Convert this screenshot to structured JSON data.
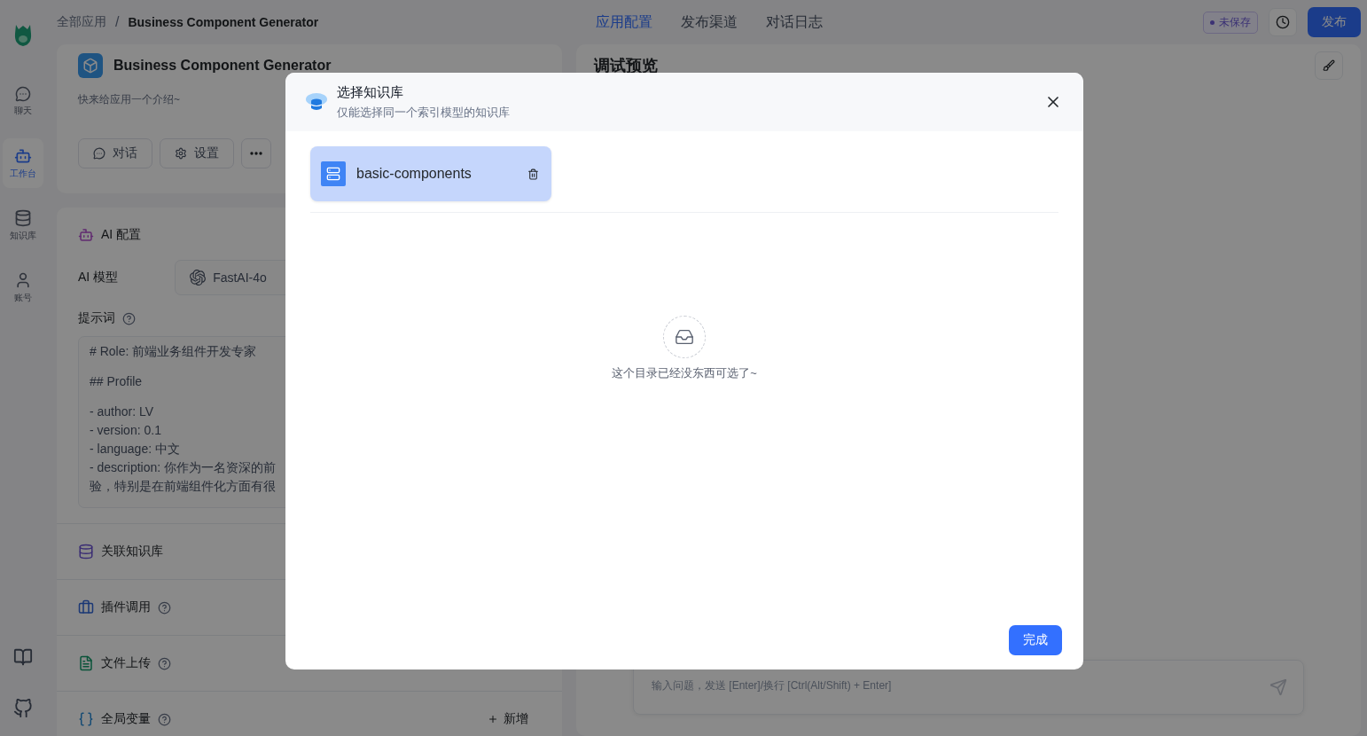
{
  "sidebar": {
    "items": [
      {
        "label": "聊天",
        "kind": "chat",
        "selected": false
      },
      {
        "label": "工作台",
        "kind": "workbench",
        "selected": true
      },
      {
        "label": "知识库",
        "kind": "dataset",
        "selected": false
      },
      {
        "label": "账号",
        "kind": "account",
        "selected": false
      }
    ]
  },
  "breadcrumb": [
    "全部应用",
    "Business Component Generator"
  ],
  "breadcrumb_separator": "/",
  "tabs": [
    {
      "label": "应用配置",
      "selected": true
    },
    {
      "label": "发布渠道",
      "selected": false
    },
    {
      "label": "对话日志",
      "selected": false
    }
  ],
  "save_status": "未保存",
  "publish_button": "发布",
  "app": {
    "name": "Business Component Generator",
    "intro": "快来给应用一个介绍~",
    "buttons": [
      {
        "label": "对话",
        "kind": "chat"
      },
      {
        "label": "设置",
        "kind": "settings"
      }
    ]
  },
  "ai_config": {
    "title": "AI 配置",
    "model_label": "AI 模型",
    "model": "FastAI-4o",
    "prompt_label": "提示词",
    "prompt_blocks": [
      [
        "# Role: 前端业务组件开发专家"
      ],
      [
        "## Profile"
      ],
      [
        "- author: LV",
        "- version: 0.1",
        "- language: 中文",
        "- description: 你作为一名资深的前",
        "验，特别是在前端组件化方面有很"
      ]
    ]
  },
  "sections": [
    {
      "label": "关联知识库",
      "kind": "dataset",
      "help": false
    },
    {
      "label": "插件调用",
      "kind": "plugin",
      "help": true
    },
    {
      "label": "文件上传",
      "kind": "file",
      "help": true
    },
    {
      "label": "全局变量",
      "kind": "variable",
      "help": true,
      "action": "新增"
    }
  ],
  "preview": {
    "title": "调试预览",
    "input_placeholder": "输入问题，发送 [Enter]/换行 [Ctrl(Alt/Shift) + Enter]"
  },
  "dialog": {
    "title": "选择知识库",
    "subtitle": "仅能选择同一个索引模型的知识库",
    "selected_datasets": [
      {
        "name": "basic-components"
      }
    ],
    "empty_text": "这个目录已经没东西可选了~",
    "confirm_button": "完成"
  }
}
